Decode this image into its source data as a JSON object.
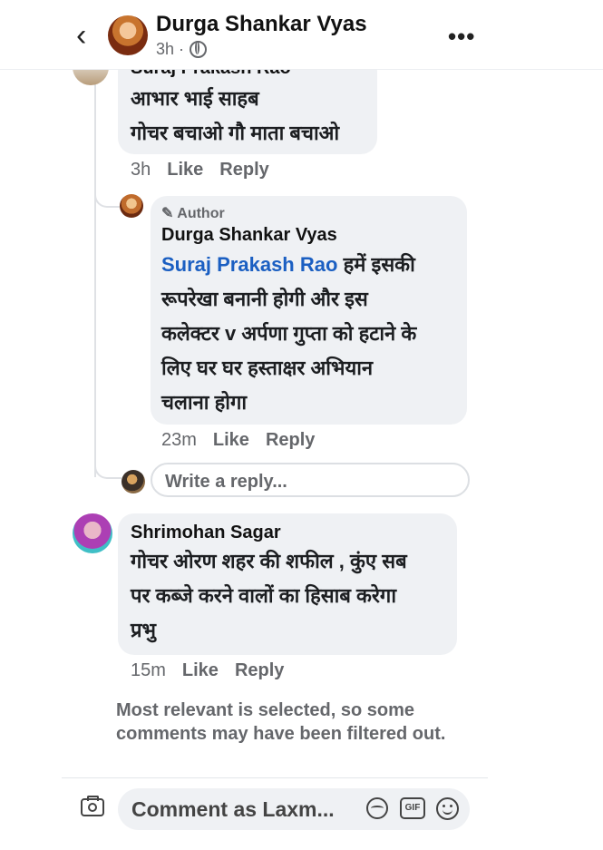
{
  "header": {
    "title": "Durga Shankar Vyas",
    "time": "3h ·",
    "back_icon": "chevron-left-icon",
    "more_icon": "more-horizontal-icon",
    "privacy_icon": "globe-icon"
  },
  "comments": [
    {
      "author": "Suraj Prakash Rao",
      "lines": [
        "आभार भाई साहब",
        "गोचर बचाओ गौ माता बचाओ"
      ],
      "time": "3h",
      "like_label": "Like",
      "reply_label": "Reply"
    },
    {
      "badge": "✎ Author",
      "author": "Durga Shankar Vyas",
      "mention": "Suraj Prakash Rao",
      "lines": [
        "हमें इसकी",
        "रूपरेखा बनानी होगी और इस",
        "कलेक्टर v अर्पणा गुप्ता को हटाने के",
        "लिए घर घर हस्ताक्षर अभियान",
        "चलाना होगा"
      ],
      "time": "23m",
      "like_label": "Like",
      "reply_label": "Reply"
    },
    {
      "author": "Shrimohan Sagar",
      "lines": [
        "गोचर ओरण शहर की शफील , कुंए सब",
        "पर कब्जे करने वालों का हिसाब करेगा",
        "प्रभु"
      ],
      "time": "15m",
      "like_label": "Like",
      "reply_label": "Reply"
    }
  ],
  "reply_input": {
    "placeholder": "Write a reply..."
  },
  "notice": "Most relevant is selected, so some comments may have been filtered out.",
  "composer": {
    "placeholder": "Comment as Laxm...",
    "gif_label": "GIF"
  }
}
